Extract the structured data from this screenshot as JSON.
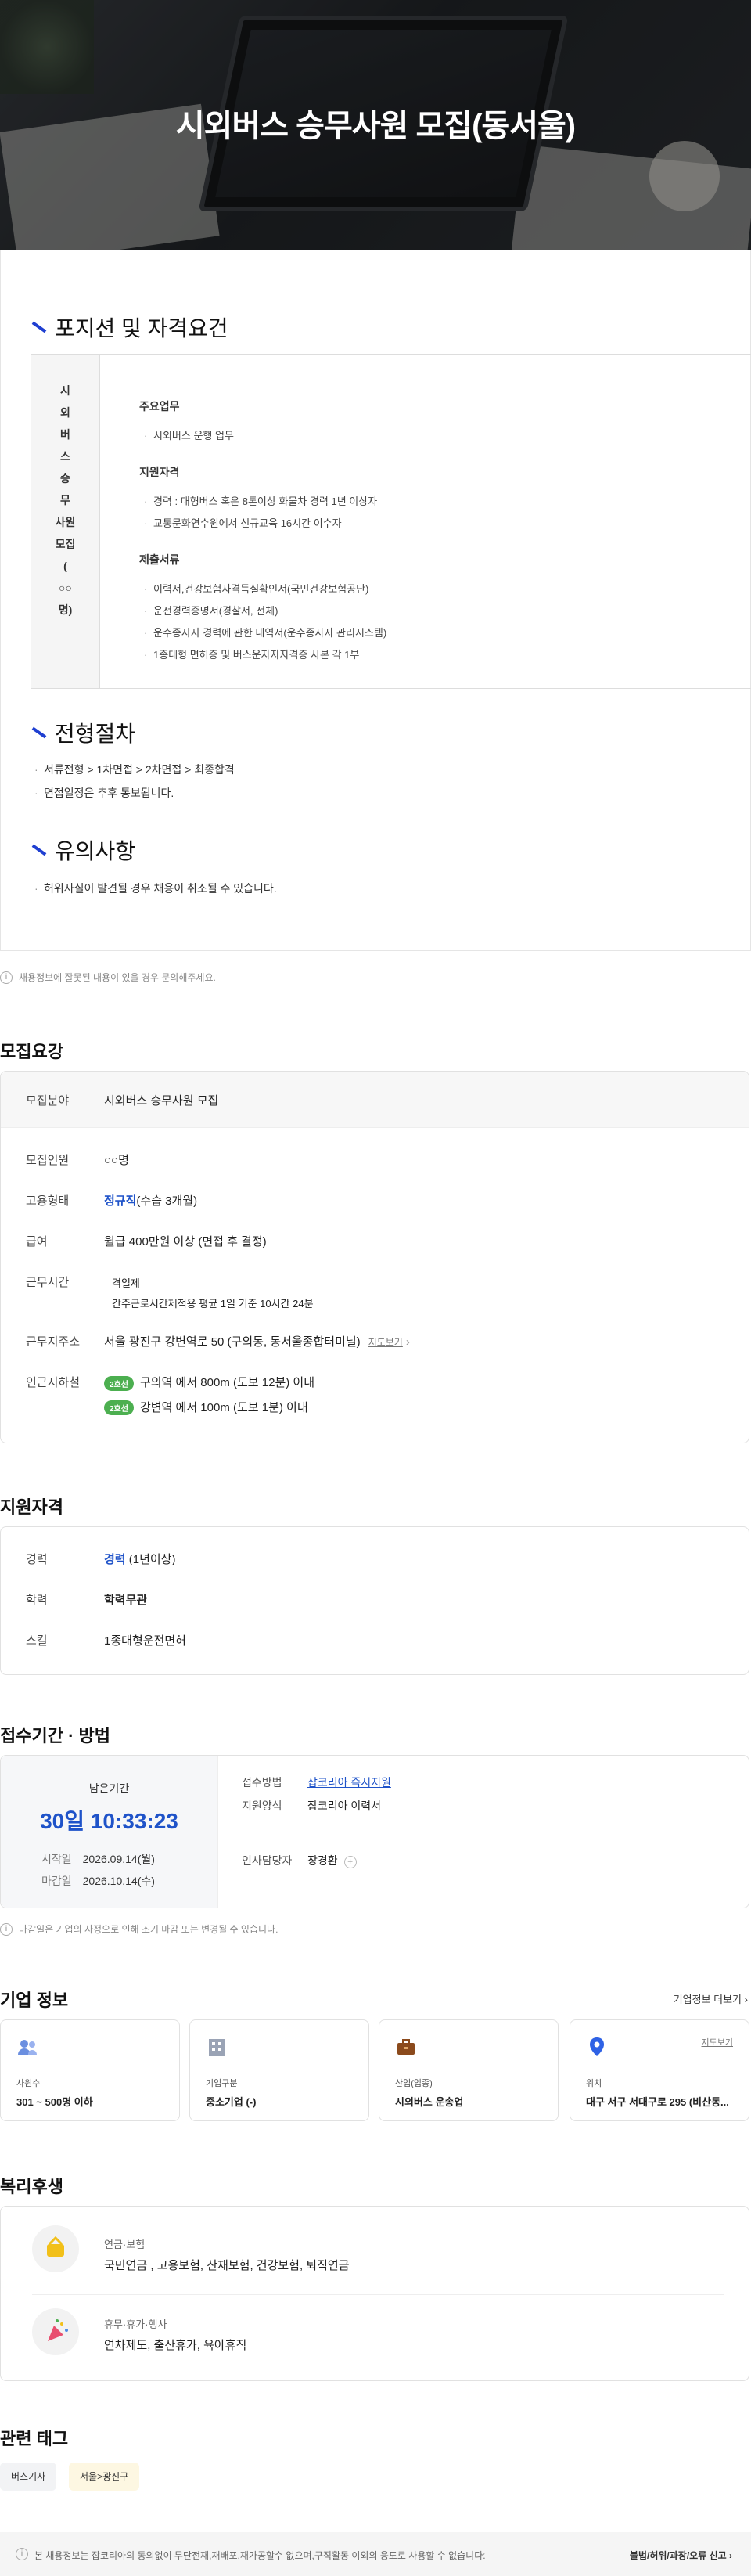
{
  "hero": {
    "title": "시외버스 승무사원 모집(동서울)"
  },
  "details": {
    "position_title": "포지션 및 자격요건",
    "position_name_chars": [
      "시",
      "외",
      "버",
      "스",
      "승",
      "무",
      "사",
      "원",
      "모",
      "집",
      "(",
      "○○",
      "명",
      ")"
    ],
    "duties": {
      "heading": "주요업무",
      "items": [
        "시외버스 운행 업무"
      ]
    },
    "qualifications": {
      "heading": "지원자격",
      "items": [
        "경력 : 대형버스 혹은 8톤이상 화물차 경력 1년 이상자",
        "교통문화연수원에서 신규교육 16시간 이수자"
      ]
    },
    "documents": {
      "heading": "제출서류",
      "items": [
        "이력서,건강보험자격득실확인서(국민건강보험공단)",
        "운전경력증명서(경찰서, 전체)",
        "운수종사자 경력에 관한 내역서(운수종사자 관리시스템)",
        "1종대형 면허증 및 버스운자자자격증 사본 각 1부"
      ]
    },
    "process_title": "전형절차",
    "process_items": [
      "서류전형 > 1차면접 > 2차면접 > 최종합격",
      "면접일정은 추후 통보됩니다."
    ],
    "caution_title": "유의사항",
    "caution_items": [
      "허위사실이 발견될 경우 채용이 취소될 수 있습니다."
    ]
  },
  "notice": "채용정보에 잘못된 내용이 있을 경우 문의해주세요.",
  "summary": {
    "title": "모집요강",
    "field_label": "모집분야",
    "field_value": "시외버스 승무사원 모집",
    "headcount_label": "모집인원",
    "headcount_value": "○○명",
    "type_label": "고용형태",
    "type_value": "정규직",
    "type_extra": "(수습 3개월)",
    "salary_label": "급여",
    "salary_value": "월급 400만원 이상 (면접 후 결정)",
    "hours_label": "근무시간",
    "hours_items": [
      "격일제",
      "간주근로시간제적용 평균 1일 기준 10시간 24분"
    ],
    "address_label": "근무지주소",
    "address_value": "서울 광진구 강변역로 50 (구의동, 동서울종합터미널)",
    "map_link": "지도보기",
    "subway_label": "인근지하철",
    "subway": [
      {
        "line": "2호선",
        "text": "구의역 에서 800m (도보 12분) 이내"
      },
      {
        "line": "2호선",
        "text": "강변역 에서 100m (도보 1분) 이내"
      }
    ]
  },
  "apply_qual": {
    "title": "지원자격",
    "career_label": "경력",
    "career_value": "경력",
    "career_extra": "(1년이상)",
    "edu_label": "학력",
    "edu_value": "학력무관",
    "skill_label": "스킬",
    "skill_value": "1종대형운전면허"
  },
  "deadline": {
    "title": "접수기간 · 방법",
    "remaining_label": "남은기간",
    "remaining_value": "30일 10:33:23",
    "start_label": "시작일",
    "start_value": "2026.09.14(월)",
    "end_label": "마감일",
    "end_value": "2026.10.14(수)",
    "method_label": "접수방법",
    "method_value": "잡코리아 즉시지원",
    "form_label": "지원양식",
    "form_value": "잡코리아 이력서",
    "manager_label": "인사담당자",
    "manager_value": "장경환",
    "note": "마감일은 기업의 사정으로 인해 조기 마감 또는 변경될 수 있습니다."
  },
  "company": {
    "title": "기업 정보",
    "more": "기업정보 더보기",
    "cards": [
      {
        "label": "사원수",
        "value": "301 ~ 500명 이하",
        "icon": "people-icon"
      },
      {
        "label": "기업구분",
        "value": "중소기업 (-)",
        "icon": "building-icon"
      },
      {
        "label": "산업(업종)",
        "value": "시외버스 운송업",
        "icon": "briefcase-icon"
      },
      {
        "label": "위치",
        "value": "대구 서구 서대구로 295 (비산동...",
        "icon": "pin-icon",
        "link": "지도보기"
      }
    ],
    "colors": {
      "people": "#6b8fe0",
      "building": "#9aa3b5",
      "briefcase": "#8b4a1c",
      "pin": "#2f62e5"
    }
  },
  "welfare": {
    "title": "복리후생",
    "items": [
      {
        "label": "연금·보험",
        "value": "국민연금 , 고용보험, 산재보험, 건강보험, 퇴직연금"
      },
      {
        "label": "휴무·휴가·행사",
        "value": "연차제도, 출산휴가, 육아휴직"
      }
    ]
  },
  "tags": {
    "title": "관련 태그",
    "items": [
      "버스기사",
      "서울>광진구"
    ]
  },
  "footer": {
    "text": "본 채용정보는 잡코리아의 동의없이 무단전재,재배포,재가공할수 없으며,구직활동 이외의 용도로 사용할 수 없습니다.",
    "report": "불법/허위/과장/오류 신고"
  }
}
